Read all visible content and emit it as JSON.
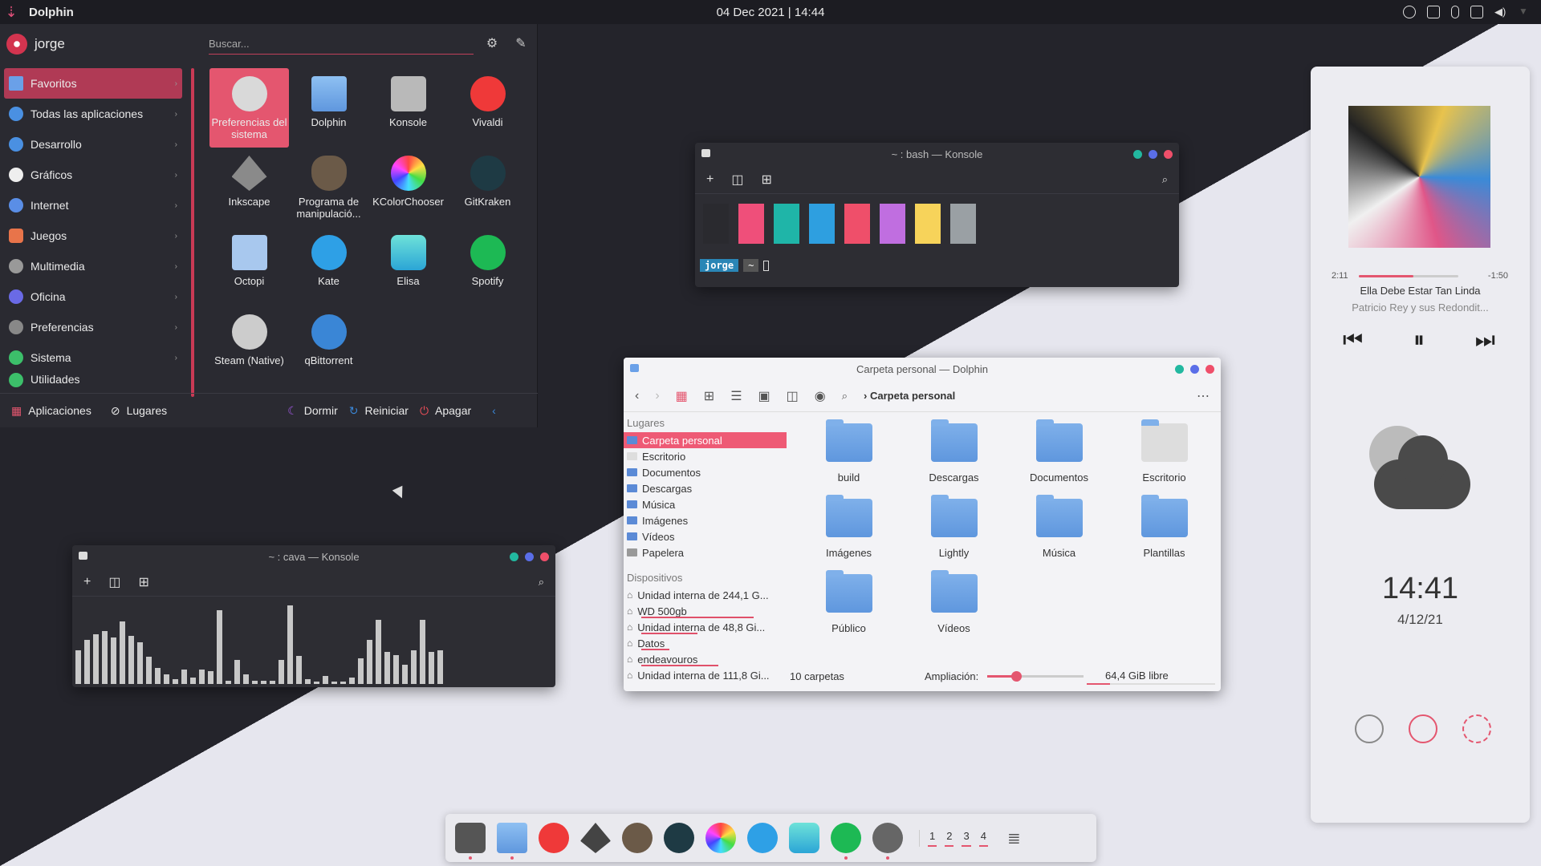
{
  "topbar": {
    "app_title": "Dolphin",
    "datetime": "04 Dec 2021 | 14:44"
  },
  "launcher": {
    "user": "jorge",
    "search_placeholder": "Buscar...",
    "categories": [
      "Favoritos",
      "Todas las aplicaciones",
      "Desarrollo",
      "Gráficos",
      "Internet",
      "Juegos",
      "Multimedia",
      "Oficina",
      "Preferencias",
      "Sistema",
      "Utilidades"
    ],
    "apps": [
      "Preferencias del sistema",
      "Dolphin",
      "Konsole",
      "Vivaldi",
      "Inkscape",
      "Programa de manipulació...",
      "KColorChooser",
      "GitKraken",
      "Octopi",
      "Kate",
      "Elisa",
      "Spotify",
      "Steam (Native)",
      "qBittorrent"
    ],
    "footer": {
      "apps": "Aplicaciones",
      "places": "Lugares",
      "sleep": "Dormir",
      "restart": "Reiniciar",
      "shutdown": "Apagar"
    }
  },
  "konsole_bash": {
    "title": "~ : bash — Konsole",
    "prompt_user": "jorge",
    "prompt_path": "~",
    "swatches": [
      "#2a2a2f",
      "#ef4f7a",
      "#1fb5a8",
      "#2e9fe0",
      "#ef4f6a",
      "#c06ee0",
      "#f7d35a",
      "#9aa0a4"
    ]
  },
  "konsole_cava": {
    "title": "~ : cava — Konsole",
    "levels": [
      0.42,
      0.55,
      0.62,
      0.66,
      0.58,
      0.78,
      0.6,
      0.52,
      0.34,
      0.2,
      0.12,
      0.06,
      0.18,
      0.08,
      0.18,
      0.16,
      0.92,
      0.04,
      0.3,
      0.12,
      0.04,
      0.04,
      0.04,
      0.3,
      0.98,
      0.35,
      0.06,
      0.03,
      0.1,
      0.03,
      0.03,
      0.08,
      0.32,
      0.55,
      0.8,
      0.4,
      0.36,
      0.24,
      0.42,
      0.8,
      0.4,
      0.42
    ]
  },
  "dolphin": {
    "title": "Carpeta personal — Dolphin",
    "breadcrumb": "Carpeta personal",
    "places_heading": "Lugares",
    "places": [
      "Carpeta personal",
      "Escritorio",
      "Documentos",
      "Descargas",
      "Música",
      "Imágenes",
      "Vídeos",
      "Papelera"
    ],
    "devices_heading": "Dispositivos",
    "devices": [
      "Unidad interna de 244,1 G...",
      "WD 500gb",
      "Unidad interna de 48,8 Gi...",
      "Datos",
      "endeavouros",
      "Unidad interna de 111,8 Gi..."
    ],
    "device_usage": [
      0.0,
      0.8,
      0.4,
      0.2,
      0.55,
      0.0
    ],
    "folders": [
      "build",
      "Descargas",
      "Documentos",
      "Escritorio",
      "Imágenes",
      "Lightly",
      "Música",
      "Plantillas",
      "Público",
      "Vídeos"
    ],
    "status_count": "10 carpetas",
    "zoom_label": "Ampliación:",
    "zoom_level": 0.3,
    "free_space": "64,4 GiB libre"
  },
  "player": {
    "elapsed": "2:11",
    "remaining": "-1:50",
    "progress": 0.55,
    "song": "Ella Debe Estar Tan Linda",
    "artist": "Patricio Rey y sus Redondit..."
  },
  "clock": {
    "time": "14:41",
    "date": "4/12/21"
  },
  "dock": {
    "pager": [
      "1",
      "2",
      "3",
      "4"
    ]
  },
  "colors": {
    "accent": "#e4566f",
    "dark_bg": "#24242b",
    "light_bg": "#e6e6ee"
  }
}
